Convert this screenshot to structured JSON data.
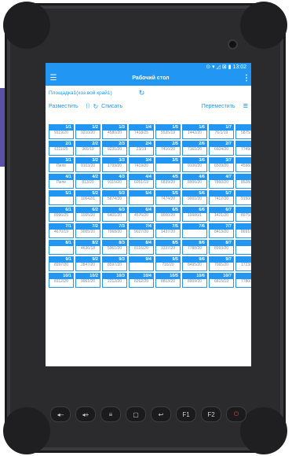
{
  "status": {
    "text": "⊙ ▾ ◿ ⊠ ▮ 13:02"
  },
  "appbar": {
    "menu_icon": "menu-icon",
    "title": "Рабочий стол",
    "more_icon": "more-vert-icon"
  },
  "location": {
    "label": "Площадка1(хоз.вой край1)",
    "refresh_icon": "refresh-icon"
  },
  "actions": {
    "place": "Разместить",
    "writeoff_icon": "scan-icon",
    "refresh_icon": "refresh-icon",
    "writeoff": "Списать",
    "move": "Переместить",
    "burger_icon": "menu-icon"
  },
  "rows": [
    [
      {
        "h": "1/1",
        "v": "9119/20"
      },
      {
        "h": "1/2",
        "v": "9210/20"
      },
      {
        "h": "1/3",
        "v": "4580/20"
      },
      {
        "h": "1/4",
        "v": "7418/25"
      },
      {
        "h": "1/5",
        "v": "5535/19"
      },
      {
        "h": "1/6",
        "v": "1442/20"
      },
      {
        "h": "1/7",
        "v": "76/1/19"
      },
      {
        "h": "1/",
        "v": "5875/20"
      }
    ],
    [
      {
        "h": "2/1",
        "v": "6111/25"
      },
      {
        "h": "2/2",
        "v": "365/19"
      },
      {
        "h": "2/3",
        "v": "9231/20"
      },
      {
        "h": "2/4",
        "v": "23/19"
      },
      {
        "h": "2/5",
        "v": "7416/20"
      },
      {
        "h": "2/6",
        "v": "7161/20"
      },
      {
        "h": "2/7",
        "v": "6604/20"
      },
      {
        "h": "2/",
        "v": "7749/20"
      }
    ],
    [
      {
        "h": "3/1",
        "v": "Пиле"
      },
      {
        "h": "3/2",
        "v": "9103/20"
      },
      {
        "h": "3/3",
        "v": "1799/20"
      },
      {
        "h": "3/4",
        "v": "7419/20"
      },
      {
        "h": "3/5",
        "v": ""
      },
      {
        "h": "3/6",
        "v": "9106/20"
      },
      {
        "h": "3/7",
        "v": "6509/20"
      },
      {
        "h": "3/",
        "v": "4598/20"
      }
    ],
    [
      {
        "h": "4/1",
        "v": "Пиле"
      },
      {
        "h": "4/2",
        "v": "813/20"
      },
      {
        "h": "4/3",
        "v": "9115/20"
      },
      {
        "h": "4/4",
        "v": "6051/19"
      },
      {
        "h": "4/5",
        "v": "6839/20"
      },
      {
        "h": "4/6",
        "v": "8906/20"
      },
      {
        "h": "4/7",
        "v": "7860/20"
      },
      {
        "h": "4/",
        "v": "8528/20"
      }
    ],
    [
      {
        "h": "5/1",
        "v": ""
      },
      {
        "h": "5/2",
        "v": "10642/1"
      },
      {
        "h": "5/3",
        "v": "5874/20"
      },
      {
        "h": "5/4",
        "v": ""
      },
      {
        "h": "5/5",
        "v": "7474/20"
      },
      {
        "h": "5/6",
        "v": "9001/20"
      },
      {
        "h": "5/7",
        "v": "7417/20"
      },
      {
        "h": "5/",
        "v": "9150/20"
      }
    ],
    [
      {
        "h": "6/1",
        "v": "8996/25"
      },
      {
        "h": "6/2",
        "v": "1005/20"
      },
      {
        "h": "6/3",
        "v": "6401/20"
      },
      {
        "h": "6/4",
        "v": "4576/20"
      },
      {
        "h": "6/5",
        "v": "9000/20"
      },
      {
        "h": "6/6",
        "v": "10086/1"
      },
      {
        "h": "6/7",
        "v": "1421/20"
      },
      {
        "h": "6/",
        "v": "8975/20"
      }
    ],
    [
      {
        "h": "7/1",
        "v": "4670/19"
      },
      {
        "h": "7/2",
        "v": "9005/20"
      },
      {
        "h": "7/3",
        "v": "7068/20"
      },
      {
        "h": "7/4",
        "v": "9027/20"
      },
      {
        "h": "7/5",
        "v": "1437/20"
      },
      {
        "h": "7/6",
        "v": ""
      },
      {
        "h": "7/7",
        "v": "8413/20"
      },
      {
        "h": "7/",
        "v": "8691/20"
      }
    ],
    [
      {
        "h": "8/1",
        "v": ""
      },
      {
        "h": "8/2",
        "v": "4636/18"
      },
      {
        "h": "8/3",
        "v": "5961/20"
      },
      {
        "h": "8/4",
        "v": "8116/20"
      },
      {
        "h": "8/5",
        "v": "3337/20"
      },
      {
        "h": "8/6",
        "v": "7788/20"
      },
      {
        "h": "8/7",
        "v": "8993/20"
      },
      {
        "h": "8/",
        "v": ""
      }
    ],
    [
      {
        "h": "9/1",
        "v": "8997/20"
      },
      {
        "h": "9/2",
        "v": "2847/20"
      },
      {
        "h": "9/3",
        "v": "8597/20"
      },
      {
        "h": "9/4",
        "v": ""
      },
      {
        "h": "9/5",
        "v": "716/20"
      },
      {
        "h": "9/6",
        "v": "8495/20"
      },
      {
        "h": "9/7",
        "v": "7065/20"
      },
      {
        "h": "9/",
        "v": "1723/20"
      }
    ],
    [
      {
        "h": "10/1",
        "v": "8112/20"
      },
      {
        "h": "10/2",
        "v": "9961/20"
      },
      {
        "h": "10/3",
        "v": "2212/20"
      },
      {
        "h": "10/4",
        "v": "8262/20"
      },
      {
        "h": "10/5",
        "v": "8813/20"
      },
      {
        "h": "10/6",
        "v": "8909/20"
      },
      {
        "h": "10/7",
        "v": "6815/19"
      },
      {
        "h": "10/",
        "v": "7780/20"
      }
    ]
  ],
  "hw_buttons": [
    {
      "name": "volume-down-icon",
      "glyph": "◂‒"
    },
    {
      "name": "volume-up-icon",
      "glyph": "◂+"
    },
    {
      "name": "menu-icon",
      "glyph": "≡"
    },
    {
      "name": "home-icon",
      "glyph": "▢"
    },
    {
      "name": "back-icon",
      "glyph": "↩"
    },
    {
      "name": "f1-icon",
      "glyph": "F1"
    },
    {
      "name": "f2-icon",
      "glyph": "F2"
    },
    {
      "name": "power-icon",
      "glyph": "⏻"
    }
  ]
}
